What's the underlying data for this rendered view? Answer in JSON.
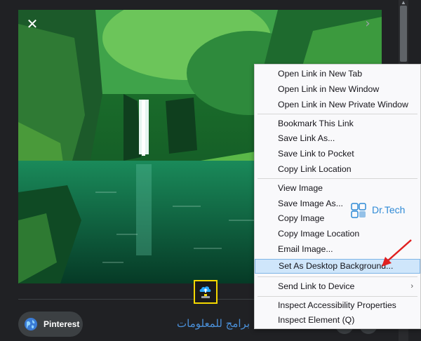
{
  "viewer": {
    "close_icon": "close-icon",
    "next_icon": "chevron-right-icon",
    "pinterest_label": "Pinterest",
    "watermark_text": "برامج للمعلومات"
  },
  "logo": {
    "text": "Dr.Tech"
  },
  "context_menu": {
    "items": [
      {
        "label": "Open Link in New Tab"
      },
      {
        "label": "Open Link in New Window"
      },
      {
        "label": "Open Link in New Private Window"
      },
      {
        "label": "Bookmark This Link"
      },
      {
        "label": "Save Link As..."
      },
      {
        "label": "Save Link to Pocket"
      },
      {
        "label": "Copy Link Location"
      },
      {
        "label": "View Image"
      },
      {
        "label": "Save Image As..."
      },
      {
        "label": "Copy Image"
      },
      {
        "label": "Copy Image Location"
      },
      {
        "label": "Email Image..."
      },
      {
        "label": "Set As Desktop Background..."
      },
      {
        "label": "Send Link to Device"
      },
      {
        "label": "Inspect Accessibility Properties"
      },
      {
        "label": "Inspect Element (Q)"
      }
    ],
    "highlighted_item": "Set As Desktop Background..."
  },
  "colors": {
    "highlight_bg": "#cfe6fb",
    "annotation_arrow": "#e02020",
    "upload_box_border": "#f5d800"
  }
}
